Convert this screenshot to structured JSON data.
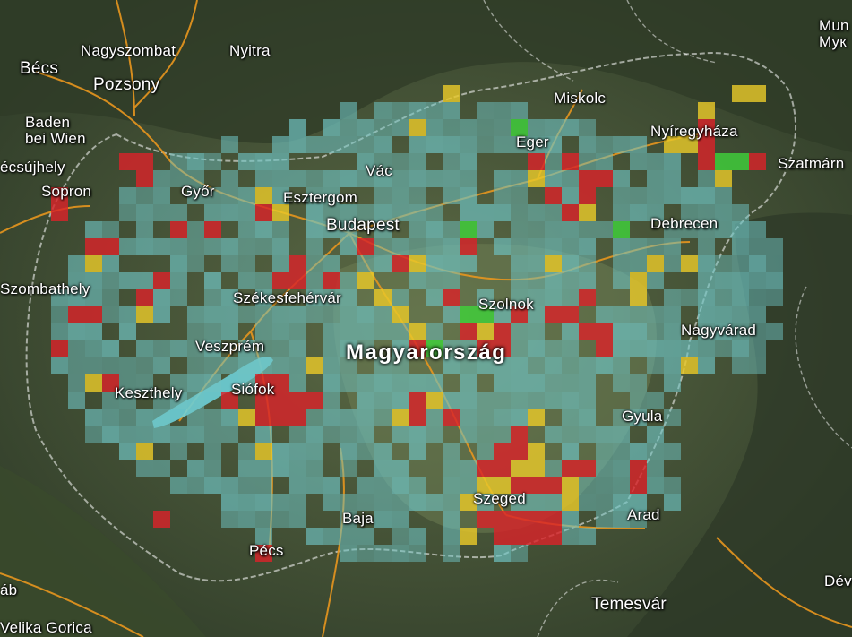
{
  "map": {
    "country_label": "Magyarország",
    "cities": [
      {
        "id": "becs",
        "name": "Bécs"
      },
      {
        "id": "pozsony",
        "name": "Pozsony"
      },
      {
        "id": "nagyszombat",
        "name": "Nagyszombat"
      },
      {
        "id": "nyitra",
        "name": "Nyitra"
      },
      {
        "id": "baden",
        "name": "Baden\nbei Wien"
      },
      {
        "id": "ecsujhely",
        "name": "écsújhely"
      },
      {
        "id": "sopron",
        "name": "Sopron"
      },
      {
        "id": "gyor",
        "name": "Győr"
      },
      {
        "id": "esztergom",
        "name": "Esztergom"
      },
      {
        "id": "vac",
        "name": "Vác"
      },
      {
        "id": "budapest",
        "name": "Budapest"
      },
      {
        "id": "miskolc",
        "name": "Miskolc"
      },
      {
        "id": "eger",
        "name": "Eger"
      },
      {
        "id": "nyiregyhaza",
        "name": "Nyíregyháza"
      },
      {
        "id": "szatmarn",
        "name": "Szatmárn"
      },
      {
        "id": "debrecen",
        "name": "Debrecen"
      },
      {
        "id": "szombathely",
        "name": "Szombathely"
      },
      {
        "id": "szekesfehervar",
        "name": "Székesfehérvár"
      },
      {
        "id": "szolnok",
        "name": "Szolnok"
      },
      {
        "id": "veszprem",
        "name": "Veszprém"
      },
      {
        "id": "nagyvarad",
        "name": "Nagyvárad"
      },
      {
        "id": "keszthely",
        "name": "Keszthely"
      },
      {
        "id": "siofok",
        "name": "Siófok"
      },
      {
        "id": "gyula",
        "name": "Gyula"
      },
      {
        "id": "szeged",
        "name": "Szeged"
      },
      {
        "id": "baja",
        "name": "Baja"
      },
      {
        "id": "arad",
        "name": "Arad"
      },
      {
        "id": "pecs",
        "name": "Pécs"
      },
      {
        "id": "temesvar",
        "name": "Temesvár"
      },
      {
        "id": "mun",
        "name": "Mun\nМук"
      },
      {
        "id": "dev",
        "name": "Dév"
      },
      {
        "id": "ab",
        "name": "áb"
      },
      {
        "id": "velika",
        "name": "Velika Gorica"
      }
    ],
    "colors": {
      "base_cell": "#6fc3c3",
      "red": "#d8232a",
      "yellow": "#e8c82a",
      "green": "#3fd13a",
      "roads": "#e8961e",
      "borders": "#ffffff",
      "lake": "#6fd6e0"
    }
  }
}
